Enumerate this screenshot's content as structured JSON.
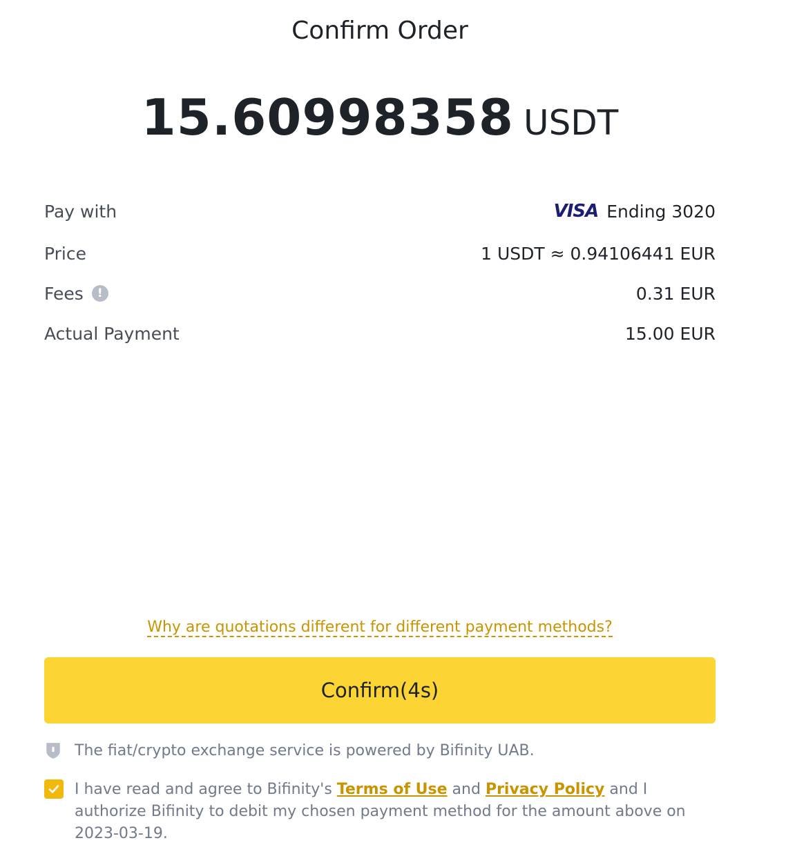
{
  "header": {
    "title": "Confirm Order"
  },
  "amount": {
    "value": "15.60998358",
    "currency": "USDT"
  },
  "details": {
    "pay_with": {
      "label": "Pay with",
      "card_brand": "VISA",
      "value": "Ending 3020"
    },
    "price": {
      "label": "Price",
      "value": "1 USDT ≈ 0.94106441 EUR"
    },
    "fees": {
      "label": "Fees",
      "info_icon": "!",
      "value": "0.31 EUR"
    },
    "actual_payment": {
      "label": "Actual Payment",
      "value": "15.00 EUR"
    }
  },
  "why_link": "Why are quotations different for different payment methods?",
  "confirm_button": "Confirm(4s)",
  "notice": "The fiat/crypto exchange service is powered by Bifinity UAB.",
  "agreement": {
    "checked": true,
    "text_before": "I have read and agree to Bifinity's ",
    "terms_link": "Terms of Use",
    "text_and": " and ",
    "privacy_link": "Privacy Policy",
    "text_after": " and I authorize Bifinity to debit my chosen payment method for the amount above on 2023-03-19."
  },
  "colors": {
    "accent": "#fcd535",
    "checkbox": "#f0b90b",
    "link": "#c99400",
    "visa": "#1a1f71"
  }
}
